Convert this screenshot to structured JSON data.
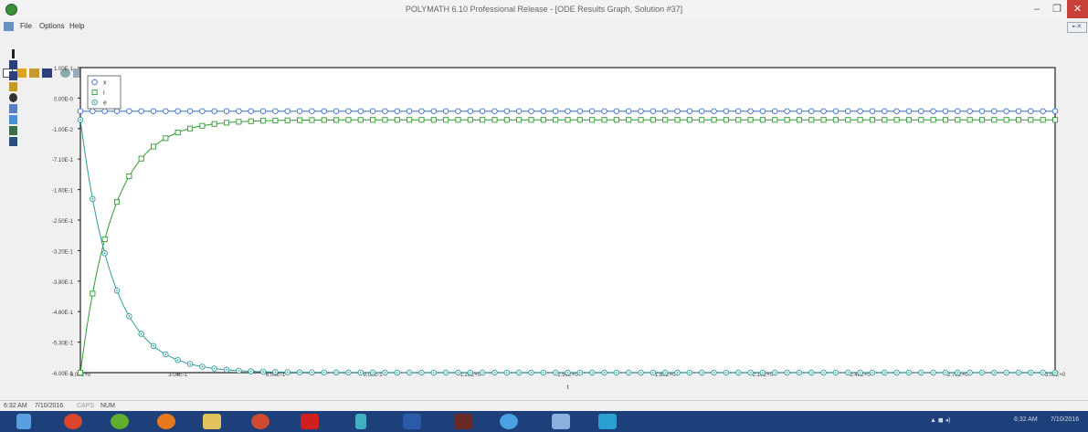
{
  "window": {
    "title": "POLYMATH 6.10 Professional Release - [ODE Results Graph, Solution #37]",
    "min_label": "–",
    "max_label": "❐",
    "close_label": "✕"
  },
  "menu": {
    "file": "File",
    "options": "Options",
    "help": "Help"
  },
  "chart_data": {
    "type": "line",
    "xlabel": "t",
    "ylim": [
      -0.6,
      0.1
    ],
    "xlim": [
      0,
      3
    ],
    "y_ticks": [
      "1.00E-1",
      "0.00E-0",
      "-1.00E-2",
      "-7.10E-1",
      "-1.60E-1",
      "-2.50E-1",
      "-3.20E-1",
      "-3.80E-1",
      "-4.60E-1",
      "-5.30E-1",
      "-6.00E-1"
    ],
    "x_ticks": [
      "0.00E+0",
      "3.00E-1",
      "6.00E-1",
      "9.00E-1",
      "1.20E+0",
      "1.50E+0",
      "1.80E+0",
      "2.10E+0",
      "2.40E+0",
      "2.70E+0",
      "3.00E+0"
    ],
    "legend_position": "top-left",
    "series": [
      {
        "name": "x",
        "marker": "circle",
        "color": "#3b6fd0",
        "equation": "constant",
        "value": 0.0
      },
      {
        "name": "i",
        "marker": "square",
        "color": "#2f9a2f",
        "equation": "rise",
        "start": -0.6,
        "end": -0.02,
        "tau": 0.1
      },
      {
        "name": "e",
        "marker": "circle-dot",
        "color": "#2f9a9a",
        "equation": "decay",
        "start": -0.02,
        "end": -0.6,
        "tau": 0.1
      }
    ]
  },
  "status": {
    "time": "6:32 AM",
    "date": "7/10/2016",
    "caps": "CAPS",
    "num": "NUM"
  },
  "taskbar": {
    "tray_time": "6:32 AM",
    "tray_date": "7/10/2016"
  }
}
